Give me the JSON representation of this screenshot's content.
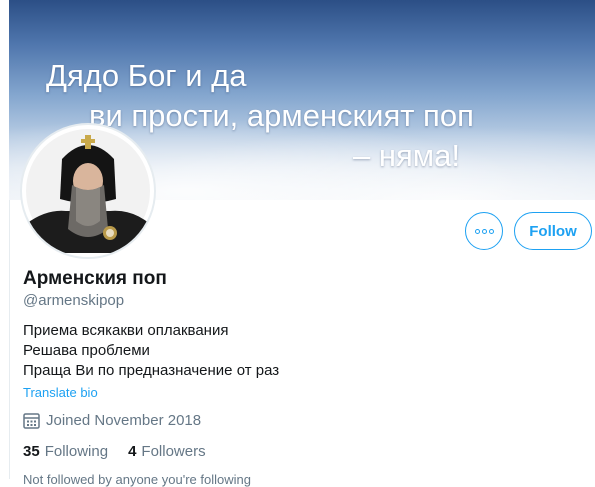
{
  "banner": {
    "line1": "Дядо Бог и да",
    "line2": "ви прости, арменският поп",
    "line3": "– няма!"
  },
  "profile": {
    "display_name": "Арменския поп",
    "handle": "@armenskipop",
    "bio_lines": [
      "Приема всякакви оплаквания",
      "Решава проблеми",
      "Праща Ви по предназначение от раз"
    ],
    "translate_label": "Translate bio",
    "joined": "Joined November 2018"
  },
  "actions": {
    "follow_label": "Follow",
    "more_icon": "more-horizontal-icon"
  },
  "stats": {
    "following_count": "35",
    "following_label": "Following",
    "followers_count": "4",
    "followers_label": "Followers"
  },
  "footer_partial": "Not followed by anyone you're following",
  "colors": {
    "accent": "#1da1f2",
    "secondary_text": "#657786",
    "primary_text": "#14171a"
  }
}
